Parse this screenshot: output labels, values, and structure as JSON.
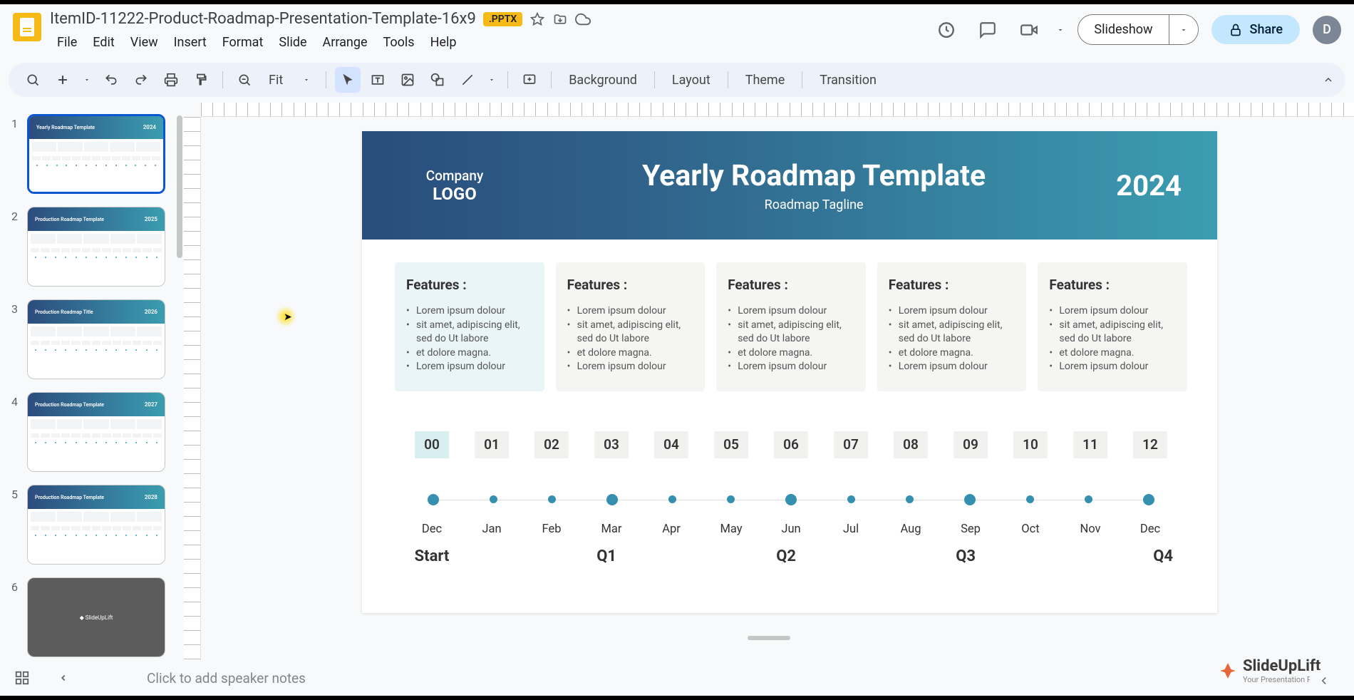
{
  "doc_title": "ItemID-11222-Product-Roadmap-Presentation-Template-16x9",
  "file_badge": ".PPTX",
  "menus": [
    "File",
    "Edit",
    "View",
    "Insert",
    "Format",
    "Slide",
    "Arrange",
    "Tools",
    "Help"
  ],
  "header_actions": {
    "slideshow_label": "Slideshow",
    "share_label": "Share",
    "avatar_initial": "D"
  },
  "toolbar": {
    "zoom_value": "Fit",
    "background_label": "Background",
    "layout_label": "Layout",
    "theme_label": "Theme",
    "transition_label": "Transition"
  },
  "slide_panel": {
    "thumbs": [
      {
        "num": "1",
        "title": "Yearly Roadmap Template",
        "year": "2024",
        "selected": true
      },
      {
        "num": "2",
        "title": "Production Roadmap Template",
        "year": "2025",
        "selected": false
      },
      {
        "num": "3",
        "title": "Production Roadmap Title",
        "year": "2026",
        "selected": false
      },
      {
        "num": "4",
        "title": "Production Roadmap Template",
        "year": "2027",
        "selected": false
      },
      {
        "num": "5",
        "title": "Production Roadmap Template",
        "year": "2028",
        "selected": false
      },
      {
        "num": "6",
        "title": "SlideUpLift",
        "year": "",
        "selected": false,
        "dark": true
      }
    ]
  },
  "slide": {
    "company_label": "Company",
    "logo_label": "LOGO",
    "title": "Yearly Roadmap Template",
    "subtitle": "Roadmap Tagline",
    "year": "2024",
    "features": [
      {
        "heading": "Features :",
        "items": [
          "Lorem ipsum dolour",
          "sit amet, adipiscing elit, sed do Ut labore",
          "et dolore magna.",
          "Lorem ipsum dolour"
        ],
        "highlighted": true
      },
      {
        "heading": "Features :",
        "items": [
          "Lorem ipsum dolour",
          "sit amet, adipiscing elit, sed do Ut labore",
          "et dolore magna.",
          "Lorem ipsum dolour"
        ],
        "highlighted": false
      },
      {
        "heading": "Features :",
        "items": [
          "Lorem ipsum dolour",
          "sit amet, adipiscing elit, sed do Ut labore",
          "et dolore magna.",
          "Lorem ipsum dolour"
        ],
        "highlighted": false
      },
      {
        "heading": "Features :",
        "items": [
          "Lorem ipsum dolour",
          "sit amet, adipiscing elit, sed do Ut labore",
          "et dolore magna.",
          "Lorem ipsum dolour"
        ],
        "highlighted": false
      },
      {
        "heading": "Features :",
        "items": [
          "Lorem ipsum dolour",
          "sit amet, adipiscing elit, sed do Ut labore",
          "et dolore magna.",
          "Lorem ipsum dolour"
        ],
        "highlighted": false
      }
    ],
    "ticks": [
      "00",
      "01",
      "02",
      "03",
      "04",
      "05",
      "06",
      "07",
      "08",
      "09",
      "10",
      "11",
      "12"
    ],
    "months": [
      "Dec",
      "Jan",
      "Feb",
      "Mar",
      "Apr",
      "May",
      "Jun",
      "Jul",
      "Aug",
      "Sep",
      "Oct",
      "Nov",
      "Dec"
    ],
    "big_dots": [
      0,
      3,
      6,
      9,
      12
    ],
    "quarters": {
      "start": "Start",
      "q1": "Q1",
      "q2": "Q2",
      "q3": "Q3",
      "q4": "Q4"
    }
  },
  "speaker_notes_placeholder": "Click to add speaker notes",
  "watermark": {
    "name": "SlideUpLift",
    "tagline": "Your Presentation Partner"
  }
}
